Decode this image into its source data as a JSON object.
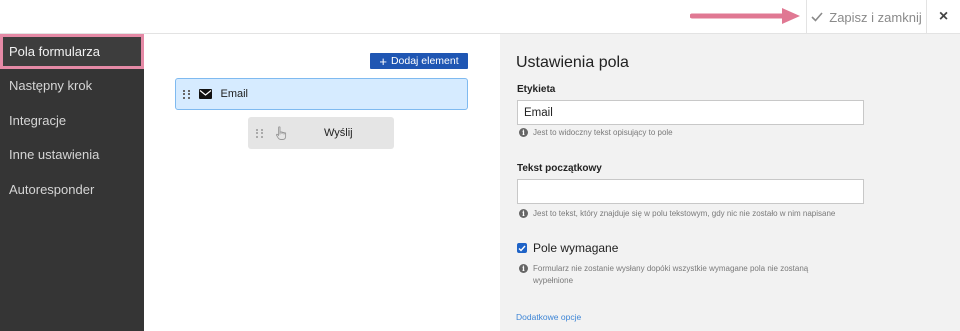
{
  "topbar": {
    "save_label": "Zapisz i zamknij",
    "close_label": "×",
    "arrow_color": "#e07893"
  },
  "sidebar": {
    "items": [
      {
        "label": "Pola formularza",
        "active": true
      },
      {
        "label": "Następny krok"
      },
      {
        "label": "Integracje"
      },
      {
        "label": "Inne ustawienia"
      },
      {
        "label": "Autoresponder"
      }
    ]
  },
  "canvas": {
    "add_button_label": "Dodaj element",
    "fields": [
      {
        "label": "Email",
        "icon": "envelope-icon",
        "selected": true
      },
      {
        "label": "Wyślij",
        "icon": "hand-pointer-icon"
      }
    ]
  },
  "settings": {
    "title": "Ustawienia pola",
    "label_heading": "Etykieta",
    "label_value": "Email",
    "label_hint": "Jest to widoczny tekst opisujący to pole",
    "initial_heading": "Tekst początkowy",
    "initial_value": "",
    "initial_hint": "Jest to tekst, który znajduje się w polu tekstowym, gdy nic nie zostało w nim napisane",
    "required_label": "Pole wymagane",
    "required_checked": true,
    "required_hint": "Formularz nie zostanie wysłany dopóki wszystkie wymagane pola nie zostaną wypełnione",
    "more_options": "Dodatkowe opcje"
  },
  "colors": {
    "accent_blue": "#1f56b3",
    "sidebar_bg": "#353535",
    "highlight_pink": "#e58aa6",
    "selected_field_bg": "#d6ebff"
  }
}
